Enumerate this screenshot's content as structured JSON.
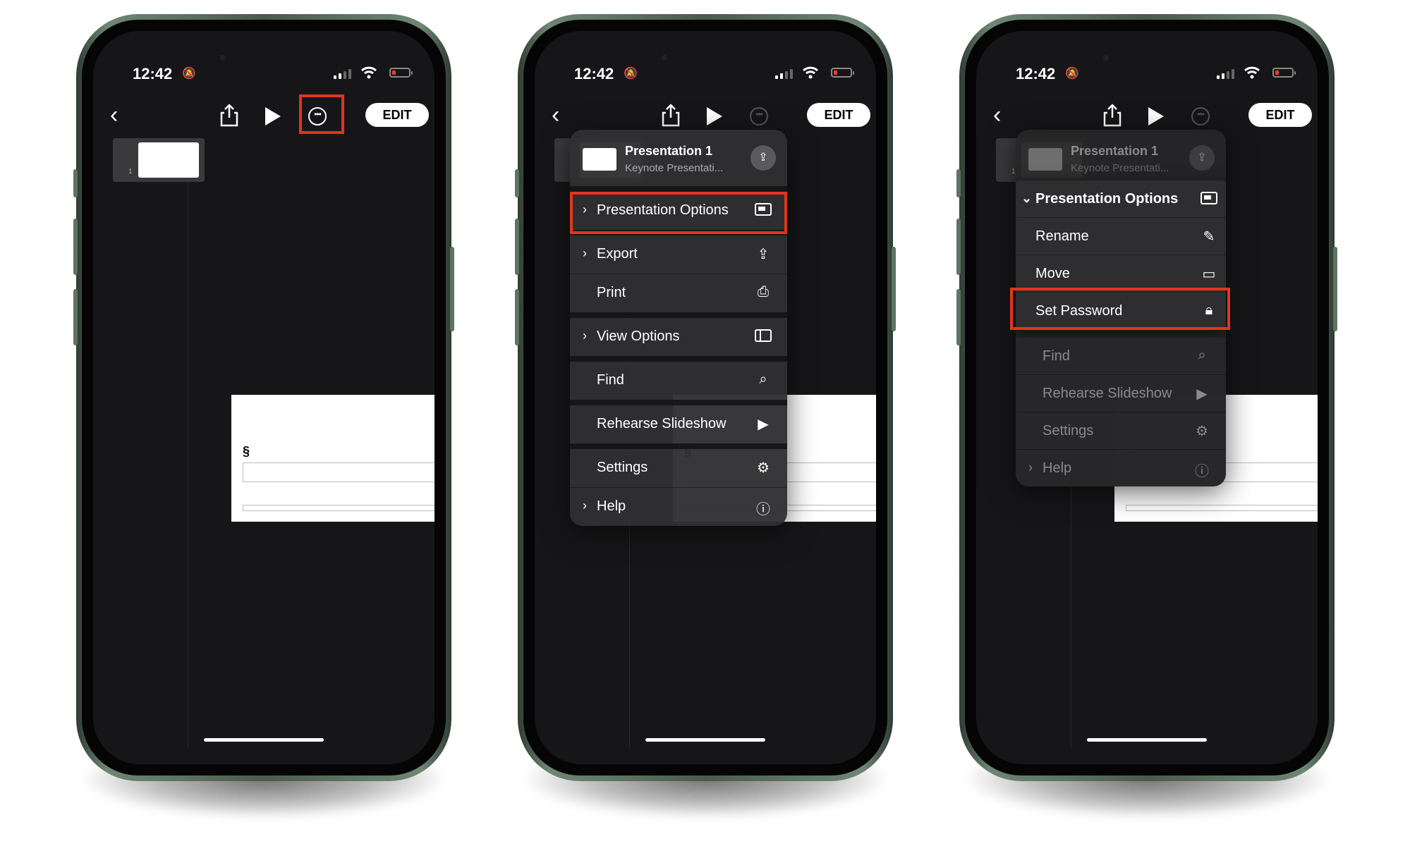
{
  "status": {
    "time": "12:42"
  },
  "toolbar": {
    "back": "‹",
    "edit_label": "EDIT"
  },
  "slide": {
    "number": "1",
    "symbol": "§"
  },
  "menu": {
    "doc_title": "Presentation 1",
    "doc_subtitle": "Keynote Presentati...",
    "items": [
      {
        "label": "Presentation Options",
        "chevron": "›",
        "icon": "presentation-icon"
      },
      {
        "label": "Export",
        "chevron": "›",
        "icon": "export-icon"
      },
      {
        "label": "Print",
        "chevron": "",
        "icon": "printer-icon"
      },
      {
        "label": "View Options",
        "chevron": "›",
        "icon": "sidebar-icon"
      },
      {
        "label": "Find",
        "chevron": "",
        "icon": "search-icon"
      },
      {
        "label": "Rehearse Slideshow",
        "chevron": "",
        "icon": "play-box-icon"
      },
      {
        "label": "Settings",
        "chevron": "",
        "icon": "gear-icon"
      },
      {
        "label": "Help",
        "chevron": "›",
        "icon": "help-icon"
      }
    ]
  },
  "submenu": {
    "title": "Presentation Options",
    "chevron": "⌄",
    "items": [
      {
        "label": "Rename",
        "icon": "pencil-icon"
      },
      {
        "label": "Move",
        "icon": "folder-icon"
      },
      {
        "label": "Set Password",
        "icon": "lock-icon"
      }
    ],
    "dim_items": [
      {
        "label": "Find",
        "icon": "search-icon"
      },
      {
        "label": "Rehearse Slideshow",
        "icon": "play-box-icon"
      },
      {
        "label": "Settings",
        "icon": "gear-icon"
      },
      {
        "label": "Help",
        "icon": "help-icon"
      }
    ]
  },
  "colors": {
    "highlight": "#e2351d",
    "frame": "#5e7462",
    "screen": "#161618"
  }
}
